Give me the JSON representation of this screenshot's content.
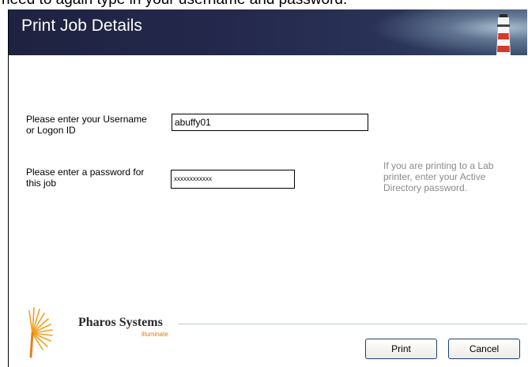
{
  "page_caption": "need to again type in your username and password:",
  "dialog": {
    "title": "Print Job Details"
  },
  "form": {
    "username_label_line1": "Please enter your Username",
    "username_label_line2": "or Logon ID",
    "username_value": "abuffy01",
    "password_label_line1": "Please enter a password for",
    "password_label_line2": "this job",
    "password_value": "xxxxxxxxxxxx"
  },
  "hint": {
    "line1": "If you are printing to a Lab",
    "line2": "printer, enter your Active",
    "line3": "Directory password."
  },
  "branding": {
    "name": "Pharos Systems",
    "tagline": "illuminate"
  },
  "buttons": {
    "print_label": "Print",
    "cancel_label": "Cancel"
  },
  "colors": {
    "header_bg": "#1f2240",
    "button_border": "#1c3f74",
    "hint_text": "#8a8a8a",
    "brand_accent": "#e07b10"
  },
  "icons": {
    "header": "lighthouse-icon",
    "logo": "sunburst-logo-icon"
  }
}
